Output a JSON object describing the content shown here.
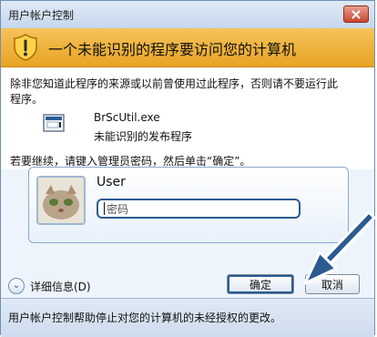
{
  "window": {
    "title": "用户帐户控制",
    "header_message": "一个未能识别的程序要访问您的计算机",
    "warning": "除非您知道此程序的来源或以前曾使用过此程序，否则请不要运行此程序。",
    "program": {
      "name": "BrScUtil.exe",
      "publisher": "未能识别的发布程序"
    },
    "continue_instruction": "若要继续，请键入管理员密码，然后单击“确定”。"
  },
  "user": {
    "name": "User",
    "password_placeholder": "密码"
  },
  "controls": {
    "details_label": "详细信息(D)",
    "ok_label": "确定",
    "cancel_label": "取消"
  },
  "footer": {
    "text": "用户帐户控制帮助停止对您的计算机的未经授权的更改。"
  },
  "icons": {
    "close": "close-icon",
    "shield": "shield-warning-icon",
    "program": "program-icon",
    "avatar": "user-avatar-icon",
    "details": "chevron-down-circle-icon",
    "pointer": "arrow-pointer-icon"
  },
  "colors": {
    "titlebar": "#c6d7ec",
    "header_band": "#e8a423",
    "window_bg": "#eef4fb",
    "accent_border": "#2a5b91",
    "close_button": "#c9452d"
  }
}
